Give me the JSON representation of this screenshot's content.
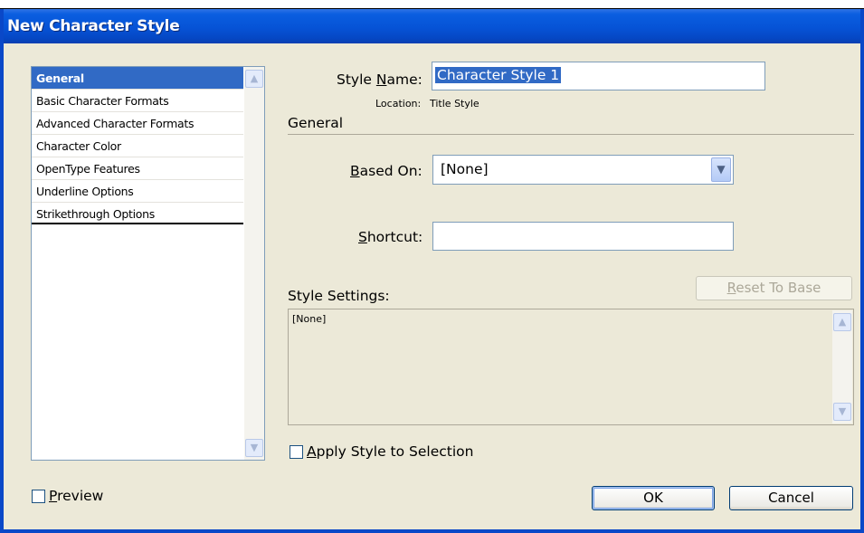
{
  "window": {
    "title": "New Character Style"
  },
  "sidebar": {
    "items": [
      {
        "label": "General",
        "selected": true
      },
      {
        "label": "Basic Character Formats"
      },
      {
        "label": "Advanced Character Formats"
      },
      {
        "label": "Character Color"
      },
      {
        "label": "OpenType Features"
      },
      {
        "label": "Underline Options"
      },
      {
        "label": "Strikethrough Options"
      }
    ]
  },
  "form": {
    "style_name_label_pre": "Style ",
    "style_name_label_ul": "N",
    "style_name_label_post": "ame:",
    "style_name_value": "Character Style 1",
    "location_label": "Location:",
    "location_value": "Title Style",
    "section_title": "General",
    "based_on_label_ul": "B",
    "based_on_label_post": "ased On:",
    "based_on_value": "[None]",
    "shortcut_label_ul": "S",
    "shortcut_label_post": "hortcut:",
    "shortcut_value": "",
    "style_settings_label": "Style Settings:",
    "reset_label_ul": "R",
    "reset_label_post": "eset To Base",
    "settings_text": "[None]",
    "apply_label_ul": "A",
    "apply_label_post": "pply Style to Selection",
    "apply_checked": false
  },
  "footer": {
    "preview_label_ul": "P",
    "preview_label_post": "review",
    "preview_checked": false,
    "ok_label": "OK",
    "cancel_label": "Cancel"
  },
  "icons": {
    "scroll_up": "scroll-up-arrow-icon",
    "scroll_down": "scroll-down-arrow-icon",
    "dropdown": "chevron-down-icon"
  },
  "colors": {
    "titlebar": "#0653d6",
    "selection": "#316ac5",
    "dialog_bg": "#ece9d8"
  }
}
